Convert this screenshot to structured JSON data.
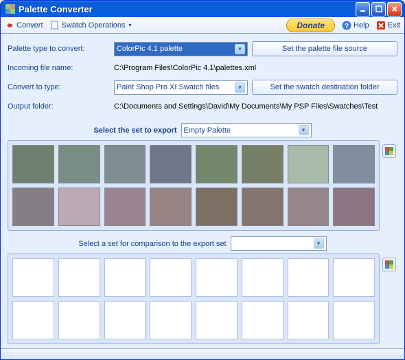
{
  "window": {
    "title": "Palette Converter"
  },
  "toolbar": {
    "convert": "Convert",
    "swatch_ops": "Swatch Operations",
    "donate": "Donate",
    "help": "Help",
    "exit": "Exit"
  },
  "form": {
    "palette_type_label": "Palette type to convert:",
    "palette_type_value": "ColorPic 4.1 palette",
    "palette_source_btn": "Set the palette file source",
    "incoming_label": "Incoming file name:",
    "incoming_value": "C:\\Program Files\\ColorPic 4.1\\palettes.xml",
    "convert_to_label": "Convert to type:",
    "convert_to_value": "Paint Shop Pro XI Swatch files",
    "swatch_dest_btn": "Set the swatch destination folder",
    "output_label": "Output folder:",
    "output_value": "C:\\Documents and Settings\\David\\My Documents\\My PSP Files\\Swatches\\Test"
  },
  "export": {
    "label": "Select the set to export",
    "dropdown": "Empty Palette"
  },
  "comparison": {
    "label": "Select a set for comparison to the export set",
    "dropdown": ""
  },
  "swatches_row1": [
    "#6e8170",
    "#768e84",
    "#7c8e93",
    "#6e7688",
    "#71886d",
    "#778066",
    "#a8bba9",
    "#818ea0"
  ],
  "swatches_row2": [
    "#867e85",
    "#bbaab6",
    "#9a8491",
    "#988485",
    "#7c7063",
    "#83746d",
    "#95868e",
    "#8a7580"
  ]
}
